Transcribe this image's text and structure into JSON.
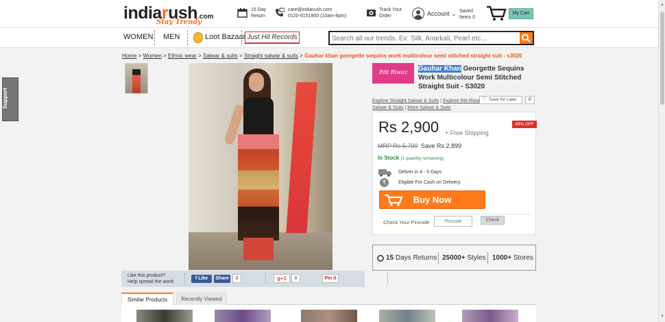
{
  "header": {
    "logo_main": "india",
    "logo_r": "r",
    "logo_rest": "ush",
    "logo_com": ".com",
    "logo_tagline": "Stay Trendy",
    "returns_line1": "15 Day",
    "returns_line2": "Return",
    "email": "care@indiarush.com",
    "phone": "0120-6151800 (10am-8pm)",
    "track_line1": "Track Your",
    "track_line2": "Order",
    "account_label": "Account",
    "saved_line1": "Saved",
    "saved_line2": "Items",
    "saved_count": "0",
    "cart_label": "My Cart"
  },
  "nav": {
    "women": "WOMEN",
    "men": "MEN",
    "loot": "Loot Bazaar",
    "hit": "Just Hit Records",
    "search_placeholder": "Search all our trends. Ex: Silk, Anarkali, Pearl etc..."
  },
  "breadcrumb": {
    "items": [
      "Home",
      "Women",
      "Ethnic wear",
      "Salwar & suits",
      "Straight salwar & suits"
    ],
    "current": "Gauhar khan georgette sequins work multicolour semi stitched straight suit - s3020",
    "separator": ">"
  },
  "share": {
    "line1": "Like this product?",
    "line2": "Help spread the word:",
    "fb_like": "Like",
    "fb_share": "Share",
    "fb_count": "0",
    "gplus": "g+1",
    "gplus_count": "0",
    "pin": "Pin it"
  },
  "product": {
    "brand_logo_text": "Riti Riwaz",
    "title_highlight": "Gauhar Khan",
    "title_rest": " Georgette Sequins Work Multicolour Semi Stitched Straight Suit - S3020",
    "explore_1": "Explore Straight Salwar & Suits",
    "explore_2": "Explore Riti Riwaz",
    "explore_3": "Salwar & Suits",
    "explore_4": "More Salwar & Suits",
    "save_later": "Save for Later",
    "save_count": "0",
    "price": "Rs 2,900",
    "free_shipping": "+ Free Shipping",
    "discount": "49% OFF",
    "mrp": "MRP Rs 5,799",
    "save": "Save Rs 2,899",
    "stock": "In Stock",
    "stock_note": "(1 quantity remaining)",
    "deliver": "Deliver in 4 - 5 Days",
    "cod": "Eligible For Cash on Delivery.",
    "buy_now": "Buy Now",
    "pincode_label": "Check Your Pincode",
    "pincode_placeholder": "Pincode",
    "check_button": "Check"
  },
  "features": {
    "returns_num": "15",
    "returns_txt": "Days Returns",
    "styles_num": "25000+",
    "styles_txt": "Styles",
    "stores_num": "1000+",
    "stores_txt": "Stores"
  },
  "tabs": {
    "similar": "Similar Products",
    "recent": "Recently Viewed"
  },
  "support": "Support",
  "colors": {
    "accent_orange": "#ff7a1a",
    "fb_blue": "#3b5998",
    "discount_red": "#d9302c",
    "stock_green": "#2d8a3a",
    "highlight_blue": "#3f7fd0"
  }
}
